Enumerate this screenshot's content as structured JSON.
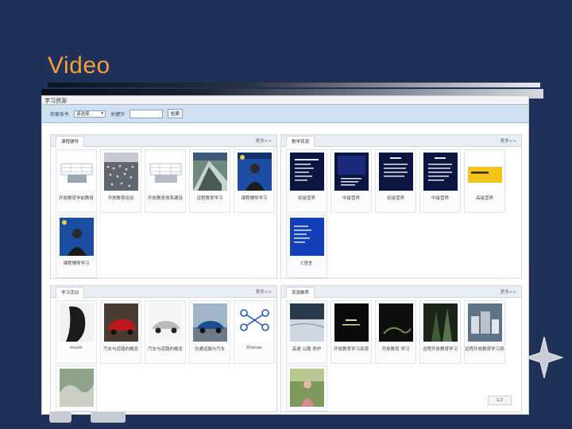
{
  "slide": {
    "title": "Video"
  },
  "portal": {
    "header_text": "学习资源",
    "search": {
      "label1": "检索条件",
      "select_value": "请选择...",
      "label2": "关键字",
      "button": "检索"
    }
  },
  "panels": [
    {
      "tab": "课程辅导",
      "more": "更多>>",
      "items": [
        {
          "caption": "开放教育学前教育",
          "thumb": "table-grid"
        },
        {
          "caption": "开放教育培训",
          "thumb": "crowd"
        },
        {
          "caption": "开放教育体系建设",
          "thumb": "table-grid"
        },
        {
          "caption": "远程教育学习",
          "thumb": "building"
        },
        {
          "caption": "课程辅导学习",
          "thumb": "presenter-blue"
        }
      ],
      "row2": [
        {
          "caption": "课程辅导学习",
          "thumb": "presenter-blue"
        }
      ]
    },
    {
      "tab": "教学资源",
      "more": "更多>>",
      "items": [
        {
          "caption": "初级营养",
          "thumb": "dark-slide"
        },
        {
          "caption": "中级营养",
          "thumb": "dark-slide"
        },
        {
          "caption": "初级营养",
          "thumb": "dark-slide"
        },
        {
          "caption": "中级营养",
          "thumb": "dark-slide"
        },
        {
          "caption": "高级营养",
          "thumb": "yellow-slide"
        }
      ],
      "row2": [
        {
          "caption": "C语言",
          "thumb": "blue-slide"
        }
      ]
    },
    {
      "tab": "学习活动",
      "more": "更多>>",
      "items": [
        {
          "caption": "music",
          "thumb": "bw-portrait"
        },
        {
          "caption": "汽车与道路的概念",
          "thumb": "red-car"
        },
        {
          "caption": "汽车与道路的概念",
          "thumb": "silver-car"
        },
        {
          "caption": "交通运输与汽车",
          "thumb": "blue-car"
        },
        {
          "caption": "Drones",
          "thumb": "drone"
        }
      ],
      "row2": [
        {
          "caption": "",
          "thumb": "landscape"
        }
      ]
    },
    {
      "tab": "资源推荐",
      "more": "更多>>",
      "items": [
        {
          "caption": "高速 公路 养护",
          "thumb": "snow"
        },
        {
          "caption": "开放教育学习资源",
          "thumb": "dark-text"
        },
        {
          "caption": "开放教育 学习",
          "thumb": "night"
        },
        {
          "caption": "远程开放教育学习",
          "thumb": "forest"
        },
        {
          "caption": "远程开放教育学习资源",
          "thumb": "city"
        }
      ],
      "row2": [
        {
          "caption": "",
          "thumb": "person-field"
        }
      ],
      "pager": "1/2"
    }
  ],
  "colors": {
    "background": "#1f3158",
    "title": "#f3a13a"
  }
}
